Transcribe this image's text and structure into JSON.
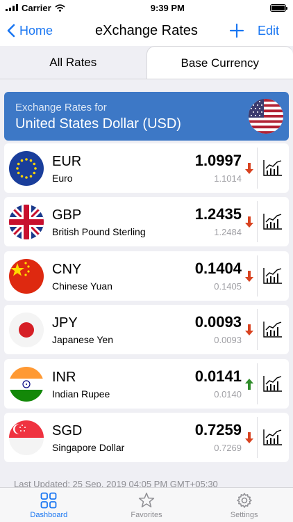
{
  "status_bar": {
    "carrier": "Carrier",
    "time": "9:39 PM",
    "battery_level": 1.0
  },
  "nav": {
    "back_label": "Home",
    "title": "eXchange Rates",
    "edit_label": "Edit"
  },
  "tabs": [
    {
      "label": "All Rates",
      "active": true
    },
    {
      "label": "Base Currency",
      "active": false
    }
  ],
  "base": {
    "subtitle": "Exchange Rates for",
    "currency": "United States Dollar (USD)",
    "flag_icon": "us-flag-icon"
  },
  "rates": [
    {
      "code": "EUR",
      "name": "Euro",
      "rate": "1.0997",
      "previous": "1.1014",
      "trend": "down",
      "flag_icon": "eu-flag-icon"
    },
    {
      "code": "GBP",
      "name": "British Pound Sterling",
      "rate": "1.2435",
      "previous": "1.2484",
      "trend": "down",
      "flag_icon": "uk-flag-icon"
    },
    {
      "code": "CNY",
      "name": "Chinese Yuan",
      "rate": "0.1404",
      "previous": "0.1405",
      "trend": "down",
      "flag_icon": "china-flag-icon"
    },
    {
      "code": "JPY",
      "name": "Japanese Yen",
      "rate": "0.0093",
      "previous": "0.0093",
      "trend": "down",
      "flag_icon": "japan-flag-icon"
    },
    {
      "code": "INR",
      "name": "Indian Rupee",
      "rate": "0.0141",
      "previous": "0.0140",
      "trend": "up",
      "flag_icon": "india-flag-icon"
    },
    {
      "code": "SGD",
      "name": "Singapore Dollar",
      "rate": "0.7259",
      "previous": "0.7269",
      "trend": "down",
      "flag_icon": "singapore-flag-icon"
    }
  ],
  "last_updated": "Last Updated: 25 Sep, 2019 04:05 PM GMT+05:30",
  "tab_bar": [
    {
      "label": "Dashboard",
      "icon": "grid-icon",
      "active": true
    },
    {
      "label": "Favorites",
      "icon": "star-icon",
      "active": false
    },
    {
      "label": "Settings",
      "icon": "gear-icon",
      "active": false
    }
  ],
  "colors": {
    "accent": "#1976f2",
    "header_bg": "#3d78c6",
    "trend_down": "#d8421f",
    "trend_up": "#2f8c2a",
    "background": "#efeff4"
  }
}
